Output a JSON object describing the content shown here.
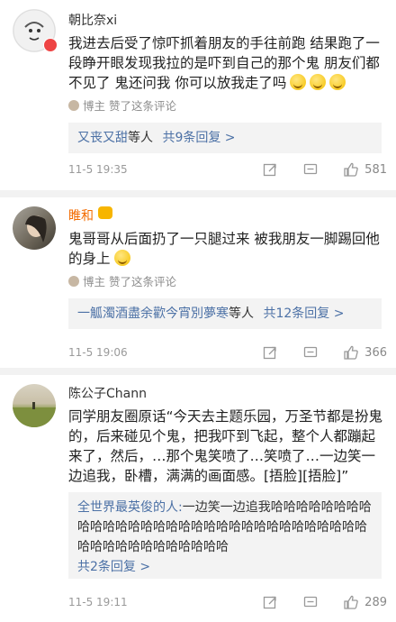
{
  "comments": [
    {
      "name": "朝比奈xi",
      "text": "我进去后受了惊吓抓着朋友的手往前跑 结果跑了一段睁开眼发现我拉的是吓到自己的那个鬼 朋友们都不见了 鬼还问我 你可以放我走了吗",
      "author_label": "博主",
      "liked_text": "赞了这条评论",
      "replies_link_user": "又丧又甜",
      "replies_link_suffix": "等人",
      "replies_count_label": "共9条回复 >",
      "time": "11-5 19:35",
      "likes": "581"
    },
    {
      "name": "睢和",
      "text": "鬼哥哥从后面扔了一只腿过来 被我朋友一脚踢回他的身上",
      "author_label": "博主",
      "liked_text": "赞了这条评论",
      "replies_link_user": "一觚濁酒盡余歡今宵別夢寒",
      "replies_link_suffix": "等人",
      "replies_count_label": "共12条回复 >",
      "time": "11-5 19:06",
      "likes": "366"
    },
    {
      "name": "陈公子Chann",
      "text": "同学朋友圈原话“今天去主题乐园，万圣节都是扮鬼的，后来碰见个鬼，把我吓到飞起，整个人都蹦起来了，然后，…那个鬼笑喷了…笑喷了…一边笑一边追我，卧槽，满满的画面感。[捂脸][捂脸]”",
      "reply_user": "全世界最英俊的人:",
      "reply_text": "一边笑一边追我哈哈哈哈哈哈哈哈哈哈哈哈哈哈哈哈哈哈哈哈哈哈哈哈哈哈哈哈哈哈哈哈哈哈哈哈哈哈哈哈哈哈哈",
      "replies_count_label": "共2条回复 >",
      "time": "11-5 19:11",
      "likes": "289"
    }
  ]
}
